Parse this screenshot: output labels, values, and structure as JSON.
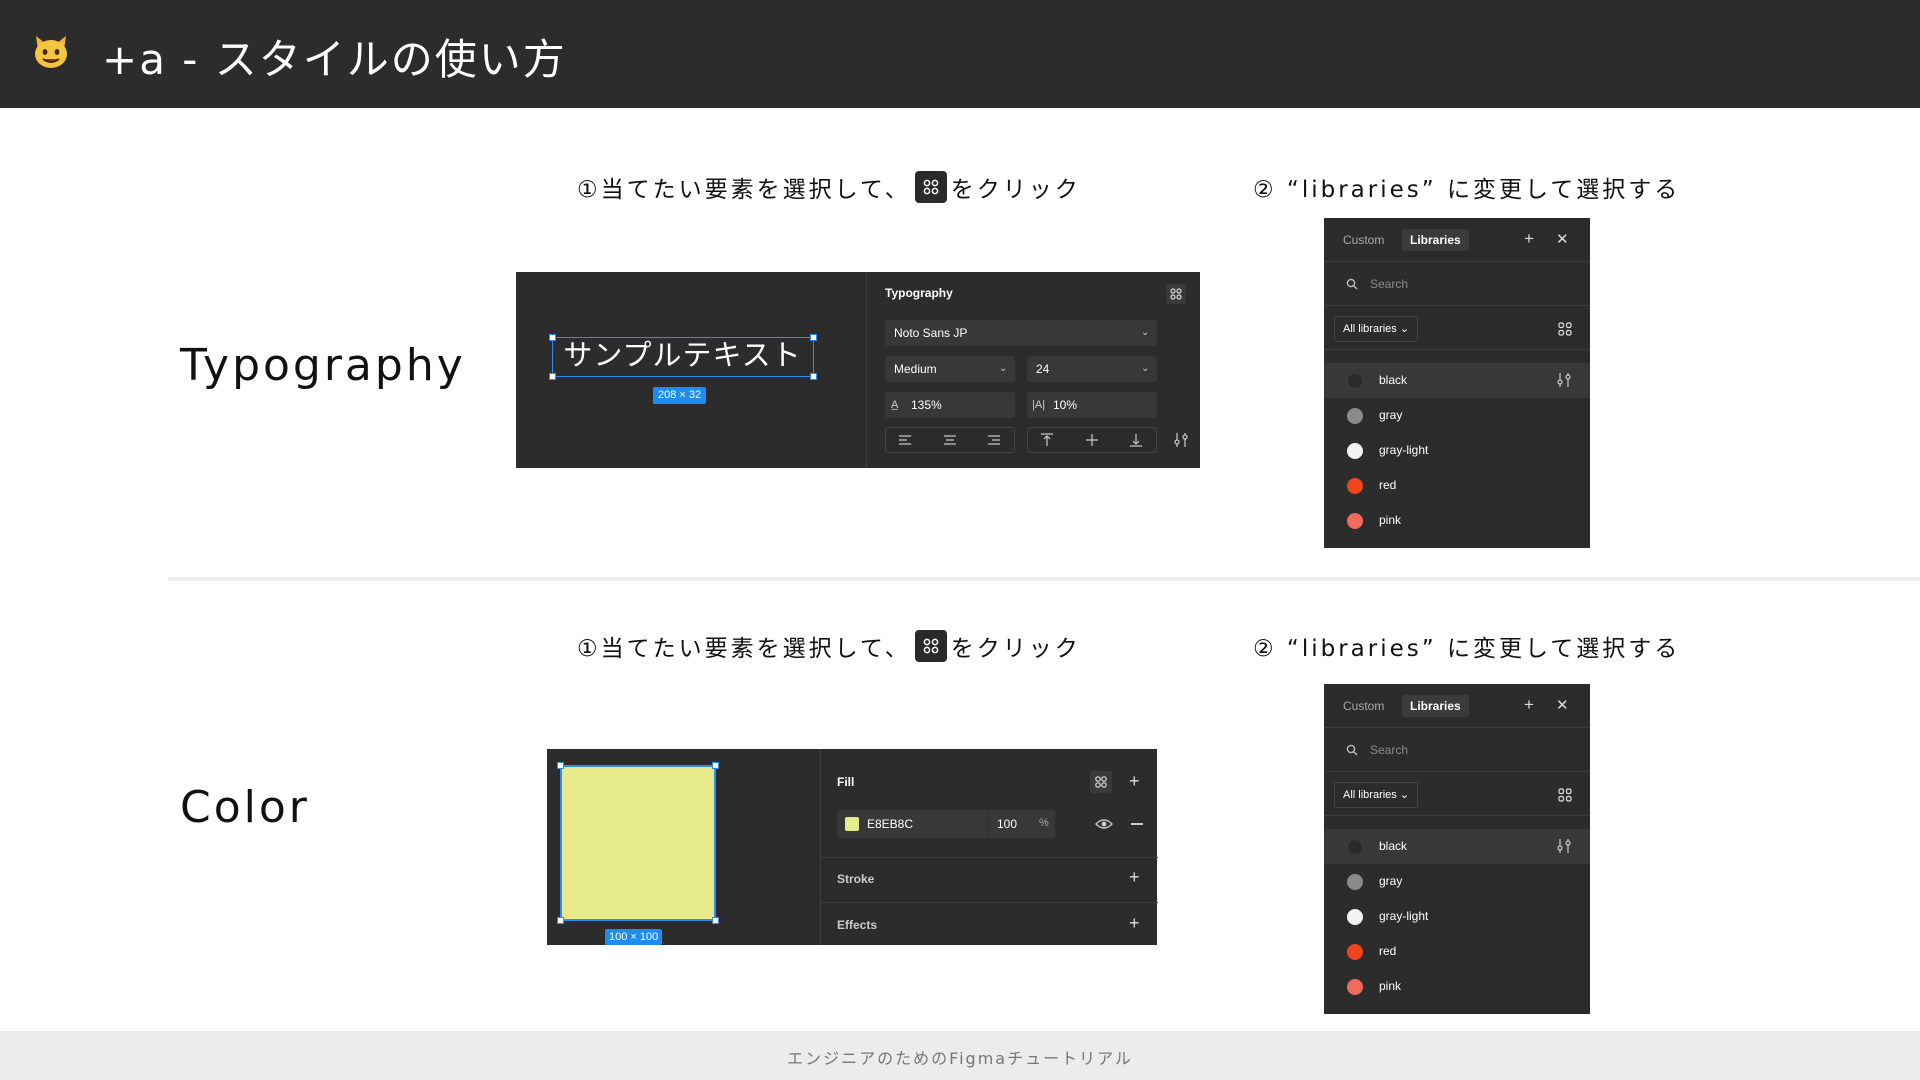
{
  "header": {
    "icon": "cat-face-icon",
    "title": "+a - スタイルの使い方"
  },
  "steps": {
    "step1_prefix": "①当てたい要素を選択して、",
    "step1_suffix": "をクリック",
    "step2": "② “libraries” に変更して選択する"
  },
  "typography_section": {
    "label": "Typography",
    "canvas": {
      "sample_text": "サンプルテキスト",
      "size_badge": "208 × 32"
    },
    "panel": {
      "heading": "Typography",
      "font_family": "Noto Sans JP",
      "font_weight": "Medium",
      "font_size": "24",
      "line_height": "135%",
      "letter_spacing": "10%"
    }
  },
  "color_section": {
    "label": "Color",
    "canvas": {
      "size_badge": "100 × 100",
      "swatch_color": "#E8EB8C"
    },
    "panel": {
      "fill_heading": "Fill",
      "fill_hex": "E8EB8C",
      "fill_opacity": "100",
      "percent_sign": "%",
      "stroke_heading": "Stroke",
      "effects_heading": "Effects"
    }
  },
  "libraries_panel": {
    "tab_custom": "Custom",
    "tab_libraries": "Libraries",
    "search_placeholder": "Search",
    "filter_label": "All libraries",
    "styles": [
      {
        "name": "black",
        "color": "#2a2a2a"
      },
      {
        "name": "gray",
        "color": "#8a8a8a"
      },
      {
        "name": "gray-light",
        "color": "#f2f2f2"
      },
      {
        "name": "red",
        "color": "#f0441f"
      },
      {
        "name": "pink",
        "color": "#f26a5e"
      }
    ]
  },
  "footer": {
    "text": "エンジニアのためのFigmaチュートリアル"
  }
}
